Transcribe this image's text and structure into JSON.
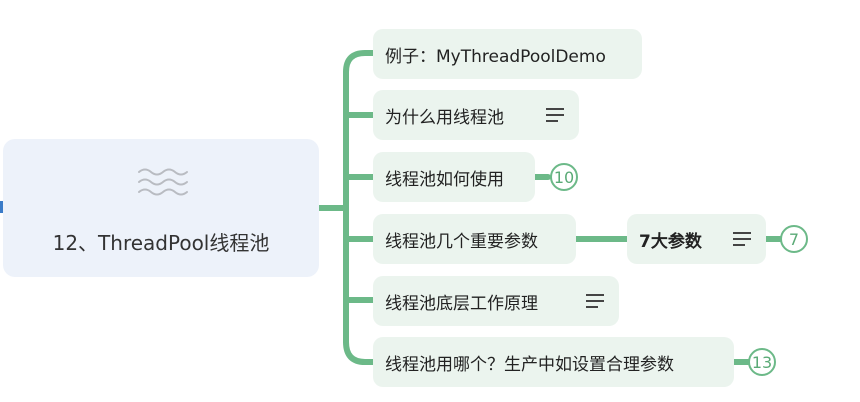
{
  "root": {
    "title": "12、ThreadPool线程池",
    "icon": "wave-topic-icon"
  },
  "branches": [
    {
      "label": "例子：MyThreadPoolDemo",
      "has_notes": false
    },
    {
      "label": "为什么用线程池",
      "has_notes": true
    },
    {
      "label": "线程池如何使用",
      "has_notes": false,
      "collapsed_count": "10"
    },
    {
      "label": "线程池几个重要参数",
      "has_notes": false,
      "child": {
        "label": "7大参数",
        "has_notes": true,
        "collapsed_count": "7"
      }
    },
    {
      "label": "线程池底层工作原理",
      "has_notes": true
    },
    {
      "label": "线程池用哪个？生产中如设置合理参数",
      "has_notes": false,
      "collapsed_count": "13"
    }
  ],
  "colors": {
    "connector": "#6cb988",
    "root_fill": "#edf2fa",
    "node_fill": "#ebf4ee",
    "badge": "#6cb988"
  }
}
